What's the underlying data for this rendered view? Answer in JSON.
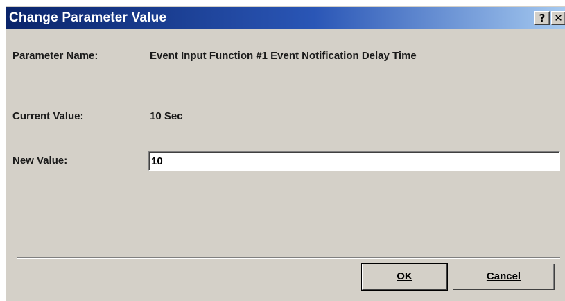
{
  "window": {
    "title": "Change Parameter Value",
    "help_glyph": "?",
    "close_glyph": "✕"
  },
  "fields": {
    "parameter_name_label": "Parameter Name:",
    "parameter_name_value": "Event Input Function #1 Event Notification Delay Time",
    "current_value_label": "Current Value:",
    "current_value": "10 Sec",
    "new_value_label": "New Value:",
    "new_value": "10"
  },
  "buttons": {
    "ok": "OK",
    "cancel": "Cancel"
  },
  "colors": {
    "titlebar_start": "#0a246a",
    "titlebar_end": "#a6caf0",
    "dialog_face": "#d4d0c8"
  },
  "icons": {
    "help": "help-icon",
    "close": "close-icon"
  }
}
